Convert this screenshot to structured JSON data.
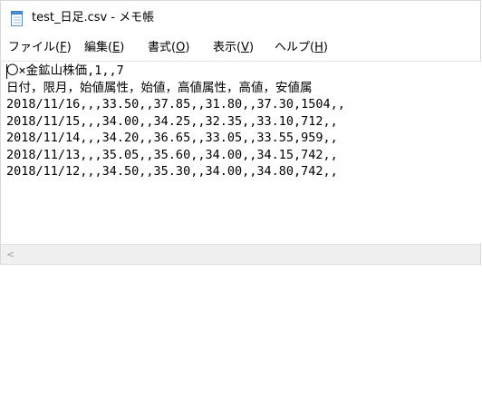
{
  "window": {
    "title": "test_日足.csv - メモ帳"
  },
  "menu": {
    "file": {
      "label": "ファイル(",
      "mnemonic": "F",
      "close": ")"
    },
    "edit": {
      "label": "編集(",
      "mnemonic": "E",
      "close": ")"
    },
    "format": {
      "label": "書式(",
      "mnemonic": "O",
      "close": ")"
    },
    "view": {
      "label": "表示(",
      "mnemonic": "V",
      "close": ")"
    },
    "help": {
      "label": "ヘルプ(",
      "mnemonic": "H",
      "close": ")"
    }
  },
  "document": {
    "lines": [
      "〇×金鉱山株価,1,,7",
      "日付，限月，始値属性，始値，高値属性，高値，安値属",
      "2018/11/16,,,33.50,,37.85,,31.80,,37.30,1504,,",
      "2018/11/15,,,34.00,,34.25,,32.35,,33.10,712,,",
      "2018/11/14,,,34.20,,36.65,,33.05,,33.55,959,,",
      "2018/11/13,,,35.05,,35.60,,34.00,,34.15,742,,",
      "2018/11/12,,,34.50,,35.30,,34.00,,34.80,742,,"
    ]
  },
  "scrollbar": {
    "left_arrow": "<"
  }
}
